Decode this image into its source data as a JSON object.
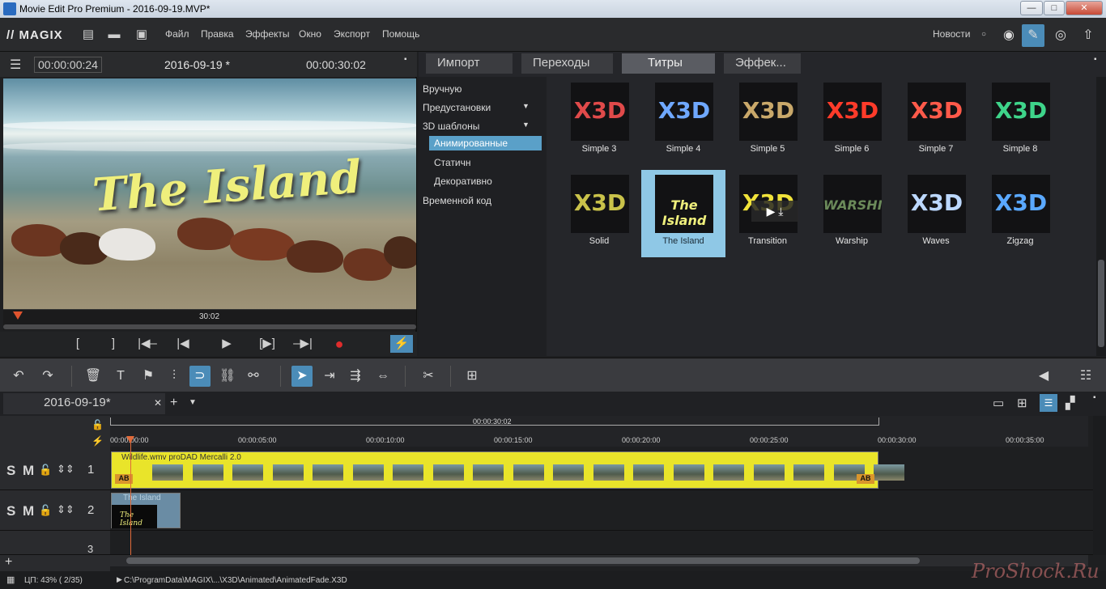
{
  "window": {
    "title": "Movie Edit Pro Premium - 2016-09-19.MVP*",
    "buttons": {
      "minimize": "—",
      "maximize": "□",
      "close": "✕"
    }
  },
  "menubar": {
    "logo": "// MAGIX",
    "items": [
      "Файл",
      "Правка",
      "Эффекты",
      "Окно",
      "Экспорт",
      "Помощь"
    ],
    "news_label": "Новости"
  },
  "preview": {
    "timecode_left": "00:00:00:24",
    "project_name": "2016-09-19 *",
    "timecode_right": "00:00:30:02",
    "video_title": "The Island",
    "scrub_time": "30:02",
    "transport": [
      "[",
      "]",
      "|◀–",
      "|◀",
      "▶",
      "[▶]",
      "–▶|",
      "●",
      "⚡"
    ]
  },
  "pool": {
    "tabs": [
      "Импорт",
      "Переходы",
      "Титры",
      "Эффек..."
    ],
    "active_tab": "Титры",
    "tree": [
      {
        "label": "Вручную",
        "level": 0
      },
      {
        "label": "Предустановки",
        "level": 0,
        "expand": true
      },
      {
        "label": "3D шаблоны",
        "level": 0,
        "expand": true
      },
      {
        "label": "Анимированные",
        "level": 1,
        "selected": true
      },
      {
        "label": "Статичн",
        "level": 1
      },
      {
        "label": "Декоративно",
        "level": 1
      },
      {
        "label": "Временной код",
        "level": 0
      }
    ],
    "tiles": [
      {
        "label": "Simple 3",
        "art": "X3D",
        "color": "#e04a4a"
      },
      {
        "label": "Simple 4",
        "art": "X3D",
        "color": "#6fa8ff"
      },
      {
        "label": "Simple 5",
        "art": "X3D",
        "color": "#c9a86a"
      },
      {
        "label": "Simple 6",
        "art": "X3D",
        "color": "#ff3b2a"
      },
      {
        "label": "Simple 7",
        "art": "X3D",
        "color": "#ff5a4a"
      },
      {
        "label": "Simple 8",
        "art": "X3D",
        "color": "#3ed48a"
      },
      {
        "label": "Solid",
        "art": "X3D",
        "color": "#c9c24a"
      },
      {
        "label": "The Island",
        "art": "The Island",
        "color": "#efef7c",
        "selected": true
      },
      {
        "label": "Transition",
        "art": "X3D",
        "color": "#f0e23a"
      },
      {
        "label": "Warship",
        "art": "WARSHIP",
        "color": "#6b8a5a"
      },
      {
        "label": "Waves",
        "art": "X3D",
        "color": "#bcd8ff"
      },
      {
        "label": "Zigzag",
        "art": "X3D",
        "color": "#5aa8ff"
      }
    ]
  },
  "timeline_tools": {
    "icons": [
      "undo-icon",
      "redo-icon",
      "delete-icon",
      "title-icon",
      "marker-icon",
      "split-icon",
      "magnet-icon",
      "link-icon",
      "unlink-icon",
      "pointer-icon",
      "ripple-icon",
      "multi-ripple-icon",
      "stretch-icon",
      "cut-icon",
      "insert-icon"
    ],
    "glyphs": [
      "↶",
      "↷",
      "🗑",
      "T",
      "⚑",
      "⫶",
      "⊃",
      "⛓",
      "⚯",
      "➤",
      "⇥",
      "⇶",
      "⇔",
      "✂",
      "⊞"
    ]
  },
  "timeline": {
    "project_tab": "2016-09-19*",
    "ruler_total": "00:00:30:02",
    "ruler_ticks": [
      "00:00:00:00",
      "00:00:05:00",
      "00:00:10:00",
      "00:00:15:00",
      "00:00:20:00",
      "00:00:25:00",
      "00:00:30:00",
      "00:00:35:00"
    ],
    "tracks": [
      {
        "number": "1",
        "label": "S M"
      },
      {
        "number": "2",
        "label": "S M"
      },
      {
        "number": "3",
        "label": ""
      }
    ],
    "clip1_label": "Wildlife.wmv   proDAD Mercalli 2.0",
    "clip2_label": "The Island",
    "clip2_thumb": "The Island",
    "ab_badge": "AB"
  },
  "status": {
    "cpu": "ЦП:  43% ( 2/35)",
    "path": "C:\\ProgramData\\MAGIX\\...\\X3D\\Animated\\AnimatedFade.X3D",
    "watermark": "ProShock.Ru"
  }
}
